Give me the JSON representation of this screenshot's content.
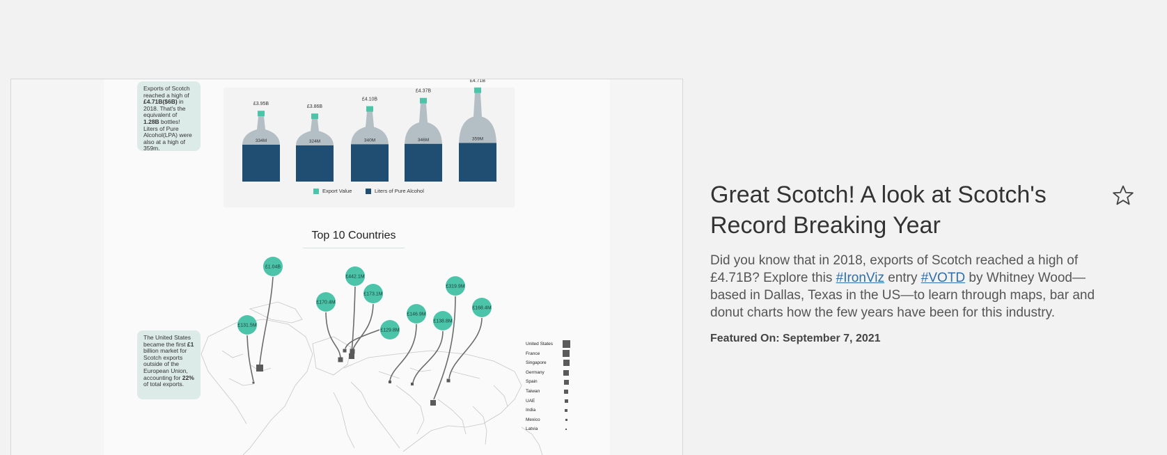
{
  "viz": {
    "callout_top": {
      "t1": "Exports of Scotch reached a high of ",
      "b1": "£4.71B($6B)",
      "t2": " in 2018. That's the equivalent of ",
      "b2": "1.28B",
      "t3": " bottles! Liters of Pure Alcohol(LPA) were also at a high of 359m."
    },
    "callout_bottom": {
      "t1": "The United States became the first ",
      "b1": "£1",
      "t2": " billion market for Scotch exports outside of the European Union, accounting for ",
      "b2": "22%",
      "t3": " of total exports."
    },
    "bottles": [
      {
        "export": "£3.95B",
        "lpa": "334M",
        "export_value": 3.95,
        "lpa_value": 334
      },
      {
        "export": "£3.86B",
        "lpa": "324M",
        "export_value": 3.86,
        "lpa_value": 324
      },
      {
        "export": "£4.10B",
        "lpa": "340M",
        "export_value": 4.1,
        "lpa_value": 340
      },
      {
        "export": "£4.37B",
        "lpa": "346M",
        "export_value": 4.37,
        "lpa_value": 346
      },
      {
        "export": "£4.71B",
        "lpa": "359M",
        "export_value": 4.71,
        "lpa_value": 359
      }
    ],
    "legend": {
      "export": "Export Value",
      "lpa": "Liters of Pure Alcohol"
    },
    "colors": {
      "teal": "#4cc4aa",
      "navy": "#1f4e72",
      "bottle_grey": "#b4bfc5",
      "marker": "#5a5a5a"
    },
    "top10_title": "Top 10 Countries",
    "bubbles": [
      "£1.04B",
      "£442.1M",
      "£173.1M",
      "£170.4M",
      "£131.5M",
      "£129.8M",
      "£146.9M",
      "£319.9M",
      "£138.8M",
      "£168.4M"
    ],
    "countries": [
      "United States",
      "France",
      "Singapore",
      "Germany",
      "Spain",
      "Taiwan",
      "UAE",
      "India",
      "Mexico",
      "Latvia"
    ]
  },
  "info": {
    "title": "Great Scotch! A look at Scotch's Record Breaking Year",
    "desc_1": "Did you know that in 2018, exports of Scotch reached a high of £4.71B? Explore this ",
    "link_ironviz": "#IronViz",
    "desc_2": " entry ",
    "link_votd": "#VOTD",
    "desc_3": " by Whitney Wood—based in Dallas, Texas in the US—to learn through maps, bar and donut charts how the few years have been for this industry.",
    "featured": "Featured On: September 7, 2021",
    "star_icon": "star-outline-icon"
  }
}
